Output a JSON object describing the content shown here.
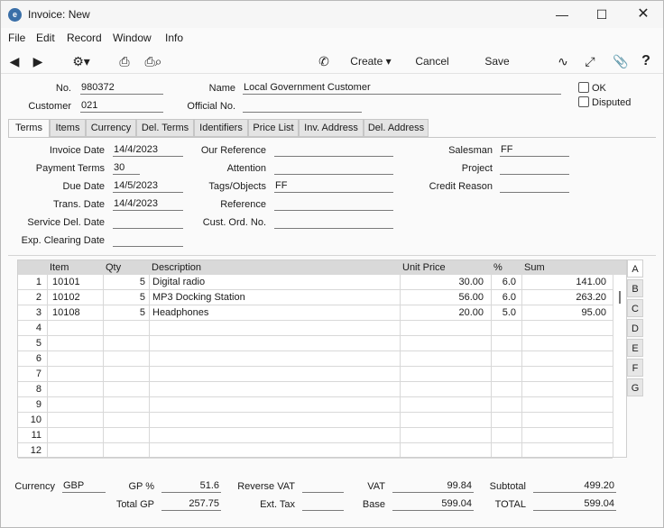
{
  "window": {
    "title": "Invoice: New"
  },
  "menu": [
    "File",
    "Edit",
    "Record",
    "Window",
    "Info"
  ],
  "toolbar": {
    "create": "Create",
    "cancel": "Cancel",
    "save": "Save"
  },
  "header": {
    "no_label": "No.",
    "no_value": "980372",
    "name_label": "Name",
    "name_value": "Local Government Customer",
    "customer_label": "Customer",
    "customer_value": "021",
    "official_label": "Official No.",
    "official_value": "",
    "ok_label": "OK",
    "disputed_label": "Disputed"
  },
  "tabs": [
    "Terms",
    "Items",
    "Currency",
    "Del. Terms",
    "Identifiers",
    "Price List",
    "Inv. Address",
    "Del. Address"
  ],
  "terms": {
    "invoice_date_label": "Invoice Date",
    "invoice_date": "14/4/2023",
    "payment_terms_label": "Payment Terms",
    "payment_terms": "30",
    "due_date_label": "Due Date",
    "due_date": "14/5/2023",
    "trans_date_label": "Trans. Date",
    "trans_date": "14/4/2023",
    "service_del_label": "Service Del. Date",
    "service_del": "",
    "exp_clearing_label": "Exp. Clearing Date",
    "exp_clearing": "",
    "our_ref_label": "Our Reference",
    "our_ref": "",
    "attention_label": "Attention",
    "attention": "",
    "tags_label": "Tags/Objects",
    "tags": "FF",
    "reference_label": "Reference",
    "reference": "",
    "cust_ord_label": "Cust. Ord. No.",
    "cust_ord": "",
    "salesman_label": "Salesman",
    "salesman": "FF",
    "project_label": "Project",
    "project": "",
    "credit_reason_label": "Credit Reason",
    "credit_reason": ""
  },
  "grid": {
    "headers": {
      "item": "Item",
      "qty": "Qty",
      "description": "Description",
      "unit_price": "Unit Price",
      "pct": "%",
      "sum": "Sum"
    },
    "rows": [
      {
        "n": "1",
        "item": "10101",
        "qty": "5",
        "description": "Digital radio",
        "unit_price": "30.00",
        "pct": "6.0",
        "sum": "141.00"
      },
      {
        "n": "2",
        "item": "10102",
        "qty": "5",
        "description": "MP3 Docking Station",
        "unit_price": "56.00",
        "pct": "6.0",
        "sum": "263.20"
      },
      {
        "n": "3",
        "item": "10108",
        "qty": "5",
        "description": "Headphones",
        "unit_price": "20.00",
        "pct": "5.0",
        "sum": "95.00"
      },
      {
        "n": "4",
        "item": "",
        "qty": "",
        "description": "",
        "unit_price": "",
        "pct": "",
        "sum": ""
      },
      {
        "n": "5",
        "item": "",
        "qty": "",
        "description": "",
        "unit_price": "",
        "pct": "",
        "sum": ""
      },
      {
        "n": "6",
        "item": "",
        "qty": "",
        "description": "",
        "unit_price": "",
        "pct": "",
        "sum": ""
      },
      {
        "n": "7",
        "item": "",
        "qty": "",
        "description": "",
        "unit_price": "",
        "pct": "",
        "sum": ""
      },
      {
        "n": "8",
        "item": "",
        "qty": "",
        "description": "",
        "unit_price": "",
        "pct": "",
        "sum": ""
      },
      {
        "n": "9",
        "item": "",
        "qty": "",
        "description": "",
        "unit_price": "",
        "pct": "",
        "sum": ""
      },
      {
        "n": "10",
        "item": "",
        "qty": "",
        "description": "",
        "unit_price": "",
        "pct": "",
        "sum": ""
      },
      {
        "n": "11",
        "item": "",
        "qty": "",
        "description": "",
        "unit_price": "",
        "pct": "",
        "sum": ""
      },
      {
        "n": "12",
        "item": "",
        "qty": "",
        "description": "",
        "unit_price": "",
        "pct": "",
        "sum": ""
      }
    ],
    "side_tabs": [
      "A",
      "B",
      "C",
      "D",
      "E",
      "F",
      "G"
    ]
  },
  "footer": {
    "currency_label": "Currency",
    "currency": "GBP",
    "gp_pct_label": "GP %",
    "gp_pct": "51.6",
    "total_gp_label": "Total GP",
    "total_gp": "257.75",
    "reverse_vat_label": "Reverse VAT",
    "reverse_vat": "",
    "ext_tax_label": "Ext. Tax",
    "ext_tax": "",
    "vat_label": "VAT",
    "vat": "99.84",
    "base_label": "Base",
    "base": "599.04",
    "subtotal_label": "Subtotal",
    "subtotal": "499.20",
    "total_label": "TOTAL",
    "total": "599.04"
  }
}
